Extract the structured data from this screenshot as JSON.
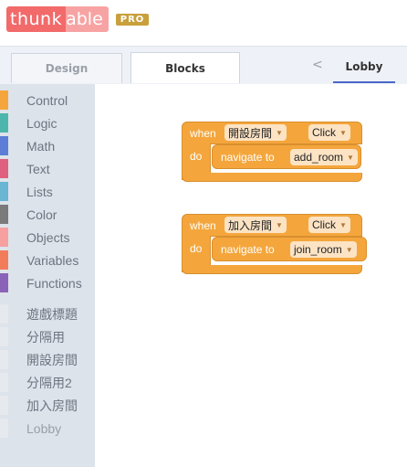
{
  "brand": {
    "name_main": "thunk",
    "name_tail": "able",
    "badge": "PRO"
  },
  "tabs": {
    "design": "Design",
    "blocks": "Blocks"
  },
  "screen": {
    "chevron": "<",
    "name": "Lobby"
  },
  "toolbox": {
    "categories": [
      {
        "label": "Control",
        "color": "#f4a63c"
      },
      {
        "label": "Logic",
        "color": "#4db6ac"
      },
      {
        "label": "Math",
        "color": "#5c7ed6"
      },
      {
        "label": "Text",
        "color": "#e06080"
      },
      {
        "label": "Lists",
        "color": "#6ab4d4"
      },
      {
        "label": "Color",
        "color": "#7a7a7a"
      },
      {
        "label": "Objects",
        "color": "#f6a0a0"
      },
      {
        "label": "Variables",
        "color": "#f27c5a"
      },
      {
        "label": "Functions",
        "color": "#8a63b8"
      }
    ],
    "components": [
      "遊戲標題",
      "分隔用",
      "開設房間",
      "分隔用2",
      "加入房間",
      "Lobby"
    ]
  },
  "blocks": [
    {
      "when": "when",
      "component": "開設房間",
      "event": "Click",
      "do": "do",
      "action": "navigate to",
      "target": "add_room"
    },
    {
      "when": "when",
      "component": "加入房間",
      "event": "Click",
      "do": "do",
      "action": "navigate to",
      "target": "join_room"
    }
  ]
}
